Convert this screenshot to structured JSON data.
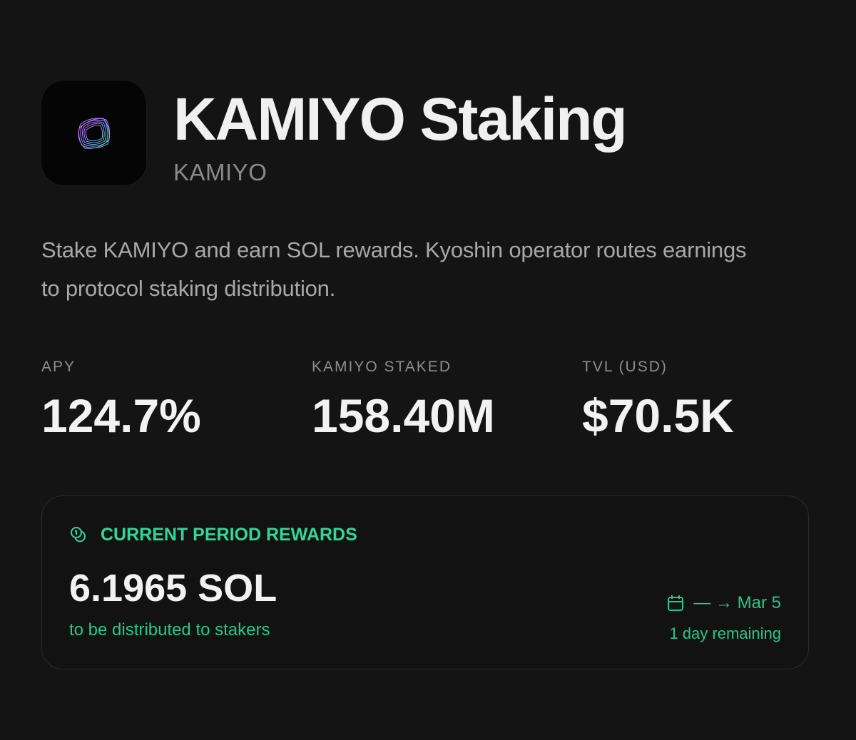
{
  "header": {
    "title": "KAMIYO Staking",
    "subtitle": "KAMIYO",
    "logo_icon": "kamiyo-logo-icon"
  },
  "description": "Stake KAMIYO and earn SOL rewards. Kyoshin operator routes earnings to protocol staking distribution.",
  "stats": [
    {
      "label": "APY",
      "value": "124.7%"
    },
    {
      "label": "KAMIYO STAKED",
      "value": "158.40M"
    },
    {
      "label": "TVL (USD)",
      "value": "$70.5K"
    }
  ],
  "rewards_card": {
    "icon": "coins-icon",
    "heading": "CURRENT PERIOD REWARDS",
    "amount": "6.1965 SOL",
    "caption": "to be distributed to stakers",
    "period_icon": "calendar-icon",
    "period": "— → Mar 5",
    "remaining": "1 day remaining"
  },
  "colors": {
    "background": "#141414",
    "accent": "#2ed89a",
    "muted_text": "#8e8e8e"
  }
}
